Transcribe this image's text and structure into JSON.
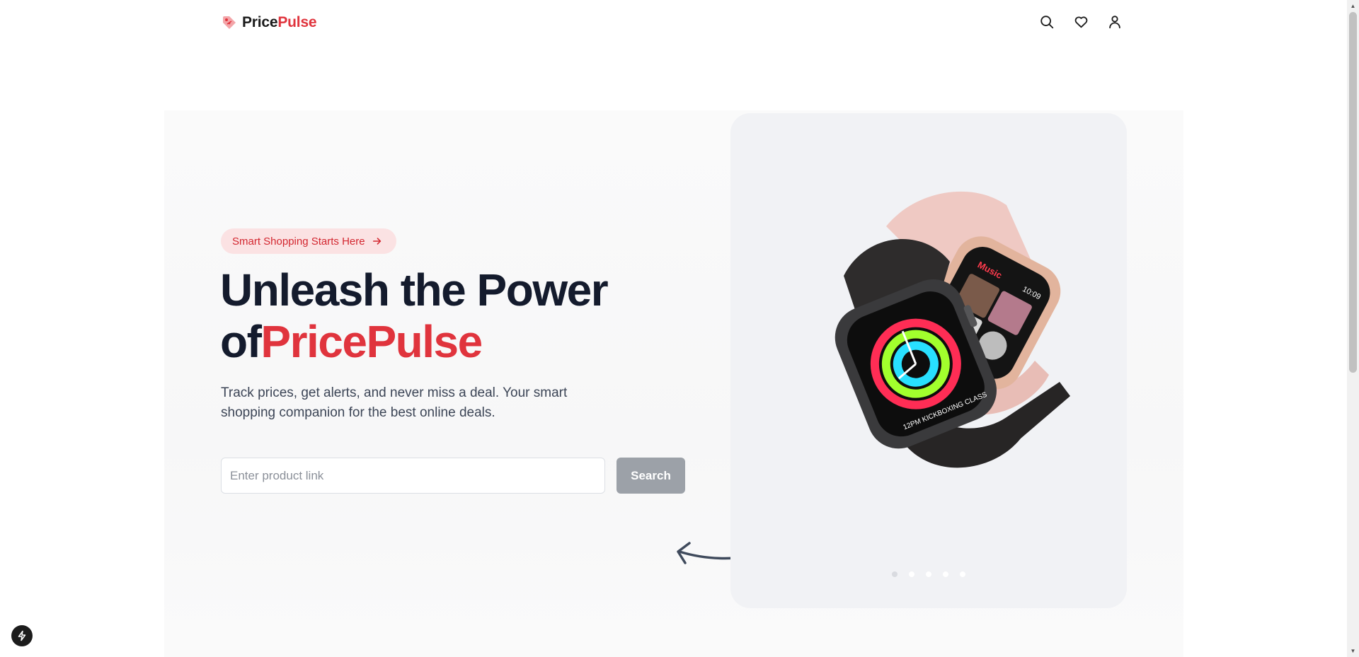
{
  "navbar": {
    "brand_prefix": "Price",
    "brand_accent": "Pulse",
    "icons": [
      "search-icon",
      "heart-icon",
      "user-icon"
    ]
  },
  "hero": {
    "badge_text": "Smart Shopping Starts Here",
    "headline_line1": "Unleash the Power",
    "headline_prefix": "of",
    "headline_accent": "PricePulse",
    "subtext": "Track prices, get alerts, and never miss a deal. Your smart shopping companion for the best online deals.",
    "search_placeholder": "Enter product link",
    "search_button": "Search"
  },
  "carousel": {
    "slide_count": 5,
    "active_index": 0
  },
  "colors": {
    "accent": "#e0343d",
    "headline": "#141b2d",
    "badge_bg": "#fbe2e3",
    "button_bg": "#9ca1a8"
  }
}
